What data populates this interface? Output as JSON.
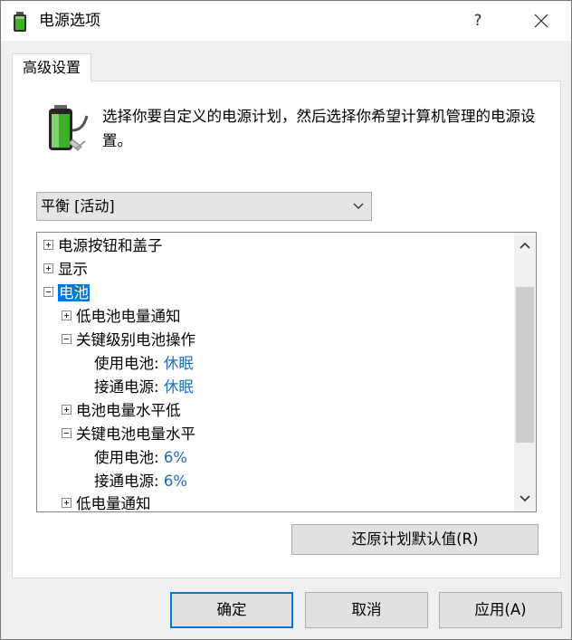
{
  "window": {
    "title": "电源选项",
    "help_label": "?"
  },
  "tabs": [
    {
      "label": "高级设置"
    }
  ],
  "description": "选择你要自定义的电源计划，然后选择你希望计算机管理的电源设置。",
  "plan_select": {
    "value": "平衡 [活动]"
  },
  "tree": [
    {
      "label": "电源按钮和盖子",
      "expander": "plus"
    },
    {
      "label": "显示",
      "expander": "plus"
    },
    {
      "label": "电池",
      "expander": "minus",
      "selected": true
    },
    {
      "label": "低电池电量通知",
      "expander": "plus"
    },
    {
      "label": "关键级别电池操作",
      "expander": "minus"
    },
    {
      "label": "使用电池:",
      "value": "休眠"
    },
    {
      "label": "接通电源:",
      "value": "休眠"
    },
    {
      "label": "电池电量水平低",
      "expander": "plus"
    },
    {
      "label": "关键电池电量水平",
      "expander": "minus"
    },
    {
      "label": "使用电池:",
      "value": "6%"
    },
    {
      "label": "接通电源:",
      "value": "6%"
    },
    {
      "label": "低电量通知",
      "expander": "plus"
    }
  ],
  "buttons": {
    "restore": "还原计划默认值(R)",
    "ok": "确定",
    "cancel": "取消",
    "apply": "应用(A)"
  },
  "colors": {
    "selection": "#0078d7",
    "value_text": "#1a6fc2",
    "battery_green": "#3fae29"
  }
}
